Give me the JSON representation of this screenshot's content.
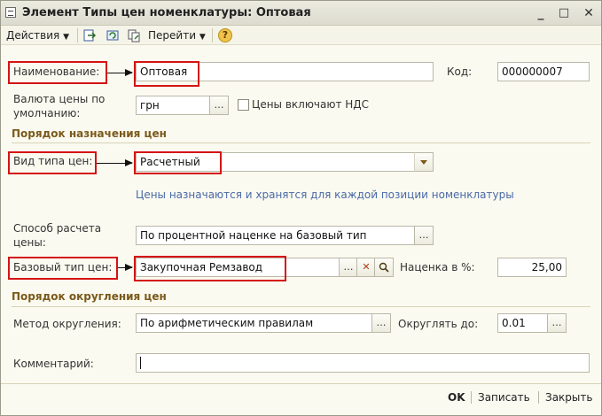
{
  "window": {
    "title": "Элемент Типы цен номенклатуры: Оптовая",
    "controls": {
      "minimize": "_",
      "maximize": "□",
      "close": "✕"
    }
  },
  "toolbar": {
    "actions_label": "Действия",
    "goto_label": "Перейти",
    "help_label": "?"
  },
  "form": {
    "name_label": "Наименование:",
    "name_value": "Оптовая",
    "code_label": "Код:",
    "code_value": "000000007",
    "currency_label_line1": "Валюта цены по",
    "currency_label_line2": "умолчанию:",
    "currency_value": "грн",
    "vat_label": "Цены включают НДС",
    "section1": "Порядок назначения цен",
    "price_type_label": "Вид типа цен:",
    "price_type_value": "Расчетный",
    "hint": "Цены назначаются и хранятся для каждой позиции номенклатуры",
    "calc_method_label_line1": "Способ расчета",
    "calc_method_label_line2": "цены:",
    "calc_method_value": "По процентной наценке на базовый тип",
    "base_type_label": "Базовый тип цен:",
    "base_type_value": "Закупочная Ремзавод",
    "markup_label": "Наценка в %:",
    "markup_value": "25,00",
    "section2": "Порядок округления цен",
    "rounding_method_label": "Метод округления:",
    "rounding_method_value": "По арифметическим правилам",
    "round_to_label": "Округлять до:",
    "round_to_value": "0.01",
    "comment_label": "Комментарий:",
    "comment_value": ""
  },
  "footer": {
    "ok_label": "OK",
    "save_label": "Записать",
    "close_label": "Закрыть"
  },
  "colors": {
    "highlight_box": "#d41414",
    "section_title": "#7a5a1a",
    "hint_text": "#4a6aa8",
    "window_bg": "#fbfaf0"
  }
}
